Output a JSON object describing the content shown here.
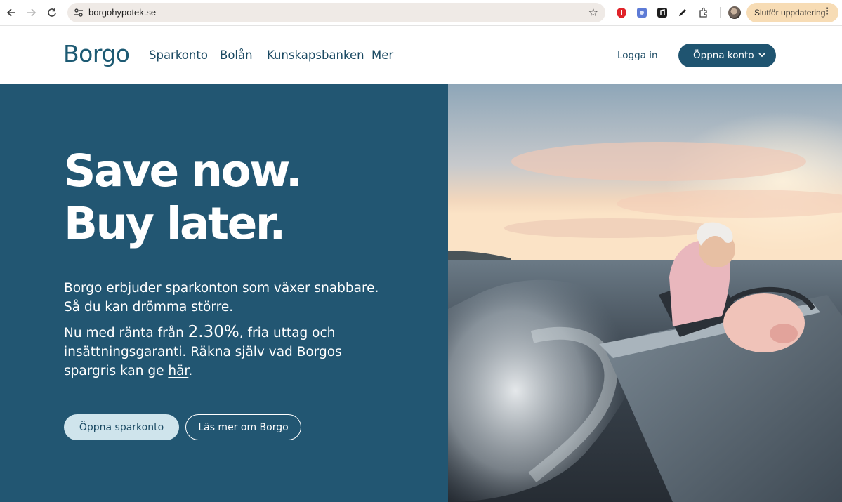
{
  "browser": {
    "url": "borgohypotek.se",
    "update_label": "Slutför uppdatering",
    "icons": [
      "back-arrow-icon",
      "forward-arrow-icon",
      "reload-icon",
      "site-info-icon",
      "bookmark-star-icon",
      "adblock-extension-icon",
      "puzzle-extension-icon",
      "music-extension-icon",
      "pen-extension-icon",
      "extensions-icon",
      "profile-avatar",
      "more-vert-icon"
    ]
  },
  "header": {
    "logo": "Borgo",
    "nav": [
      "Sparkonto",
      "Bolån",
      "Kunskapsbanken",
      "Mer"
    ],
    "login": "Logga in",
    "cta": "Öppna konto"
  },
  "hero": {
    "title_line1": "Save now.",
    "title_line2": "Buy later.",
    "para1": "Borgo erbjuder sparkonton som växer snabbare. Så du kan drömma större.",
    "para2_pre": "Nu med ränta från ",
    "para2_rate": "2.30%",
    "para2_mid": ", fria uttag och insättningsgaranti. Räkna själv vad Borgos spargris kan ge ",
    "para2_link": "här",
    "para2_end": ".",
    "btn_primary": "Öppna sparkonto",
    "btn_secondary": "Läs mer om Borgo"
  },
  "colors": {
    "brand": "#225672",
    "brand_dark": "#1f5470",
    "button_light": "#cfe4ec",
    "update_pill": "#f7dcb5"
  }
}
